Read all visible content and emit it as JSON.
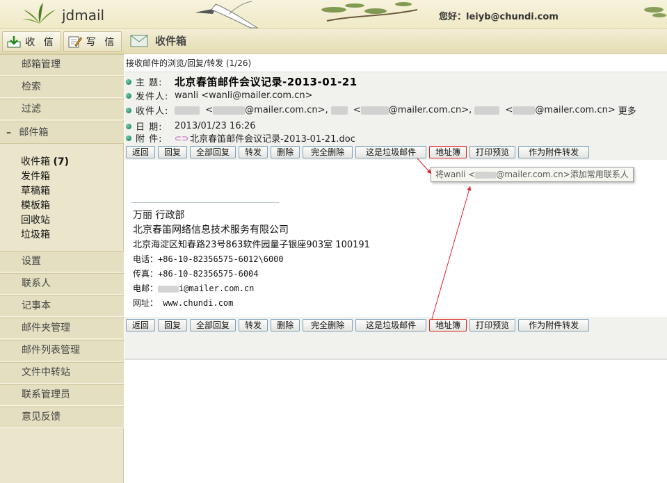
{
  "app": {
    "brand": "jdmail",
    "greeting": "您好：leiyb@chundi.com"
  },
  "toolbar": {
    "receive_label": "收 信",
    "compose_label": "写 信",
    "folder_title": "收件箱"
  },
  "sidebar": {
    "top_items": [
      "邮箱管理",
      "检索",
      "过滤"
    ],
    "mailbox_section": "邮件箱",
    "folders": [
      {
        "name": "收件箱",
        "count": "(7)"
      },
      {
        "name": "发件箱",
        "count": ""
      },
      {
        "name": "草稿箱",
        "count": ""
      },
      {
        "name": "模板箱",
        "count": ""
      },
      {
        "name": "回收站",
        "count": ""
      },
      {
        "name": "垃圾箱",
        "count": ""
      }
    ],
    "bottom_items": [
      "设置",
      "联系人",
      "记事本",
      "邮件夹管理",
      "邮件列表管理",
      "文件中转站",
      "联系管理员",
      "意见反馈"
    ]
  },
  "message": {
    "breadcrumb": "接收邮件的浏览/回复/转发 (1/26)",
    "subject_label": "主  题:",
    "subject": "北京春笛邮件会议记录-2013-01-21",
    "from_label": "发件人:",
    "from": "wanli <wanli@mailer.com.cn>",
    "to_label": "收件人:",
    "to_parts": [
      "<",
      "@mailer.com.cn>,",
      "<",
      "@mailer.com.cn>,",
      "<",
      "@mailer.com.cn>"
    ],
    "to_more": "更多",
    "date_label": "日  期:",
    "date": "2013/01/23 16:26",
    "attach_label": "附  件:",
    "attachment": "北京春笛邮件会议记录-2013-01-21.doc"
  },
  "buttons": [
    "返回",
    "回复",
    "全部回复",
    "转发",
    "删除",
    "完全删除",
    "这是垃圾邮件",
    "地址簿",
    "打印预览",
    "作为附件转发"
  ],
  "tooltip": {
    "prefix": "将wanli <",
    "suffix": "@mailer.com.cn>添加常用联系人"
  },
  "signature": {
    "name": "万丽 行政部",
    "company": "北京春笛网络信息技术服务有限公司",
    "address": "北京海淀区知春路23号863软件园量子银座903室   100191",
    "phone": "电话：+86-10-82356575-6012\\6000",
    "fax": "传真：+86-10-82356575-6004",
    "email_prefix": "电邮：",
    "email_suffix": "i@mailer.com.cn",
    "web": "网址： www.chundi.com"
  },
  "colors": {
    "sidebar_bg": "#ebe6cb",
    "highlight_border": "#dd2222",
    "arrow": "#e02020"
  }
}
